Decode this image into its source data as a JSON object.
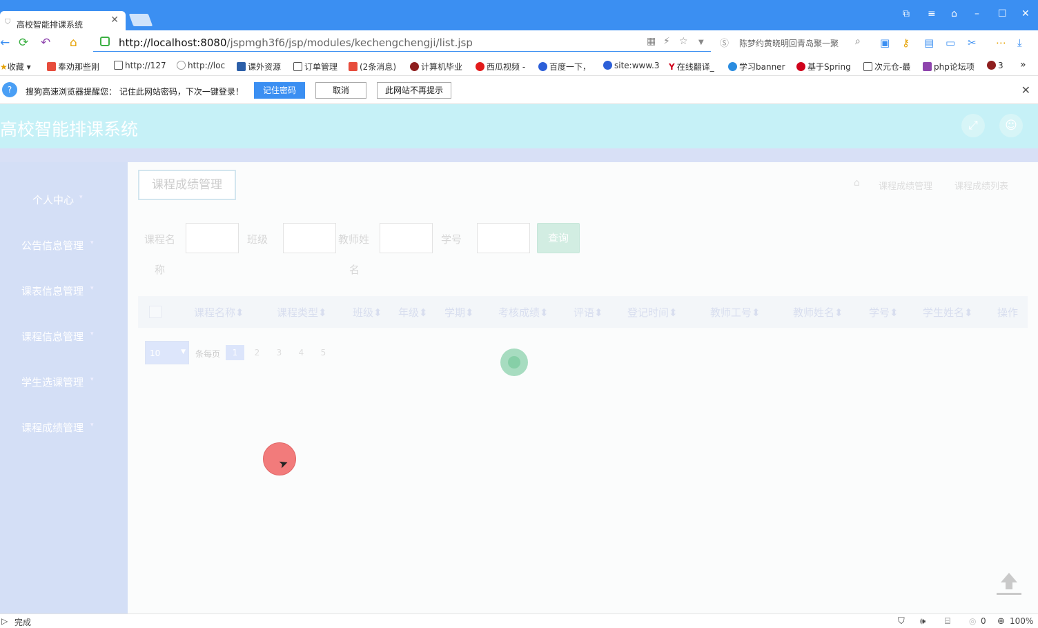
{
  "browser": {
    "tab_title": "高校智能排课系统",
    "url_host": "http://localhost:8080",
    "url_path": "/jspmgh3f6/jsp/modules/kechengchengji/list.jsp",
    "search_text": "陈梦约黄晓明回青岛聚一聚",
    "bookmarks": [
      "收藏",
      "奉劝那些刚",
      "http://127",
      "http://loc",
      "课外资源",
      "订单管理",
      "(2条消息)",
      "计算机毕业",
      "西瓜视频 -",
      "百度一下，",
      "site:www.3",
      "在线翻译_",
      "学习banner",
      "基于Spring",
      "次元仓-最",
      "php论坛项",
      "3"
    ],
    "notice": {
      "text": "搜狗高速浏览器提醒您： 记住此网站密码，下次一键登录！",
      "remember": "记住密码",
      "cancel": "取消",
      "never": "此网站不再提示"
    },
    "status": "完成",
    "zoom": "100%",
    "count": "0",
    "colors": {
      "chrome": "#3b8ff2",
      "header": "#c6f1f7",
      "sidebar": "#d4dff6"
    }
  },
  "app": {
    "title": "高校智能排课系统",
    "sidebar": [
      "个人中心",
      "公告信息管理",
      "课表信息管理",
      "课程信息管理",
      "学生选课管理",
      "课程成绩管理"
    ],
    "page_title": "课程成绩管理",
    "breadcrumb": [
      "课程成绩管理",
      "课程成绩列表"
    ],
    "filters": {
      "course_name_1": "课程名",
      "course_name_2": "称",
      "class": "班级",
      "teacher_1": "教师姓",
      "teacher_2": "名",
      "student_no": "学号",
      "query": "查询"
    },
    "columns": [
      "课程名称",
      "课程类型",
      "班级",
      "年级",
      "学期",
      "考核成绩",
      "评语",
      "登记时间",
      "教师工号",
      "教师姓名",
      "学号",
      "学生姓名",
      "操作"
    ],
    "pager": {
      "size": "10",
      "per_page": "条每页",
      "pages": [
        "1",
        "2",
        "3",
        "4",
        "5"
      ]
    }
  }
}
